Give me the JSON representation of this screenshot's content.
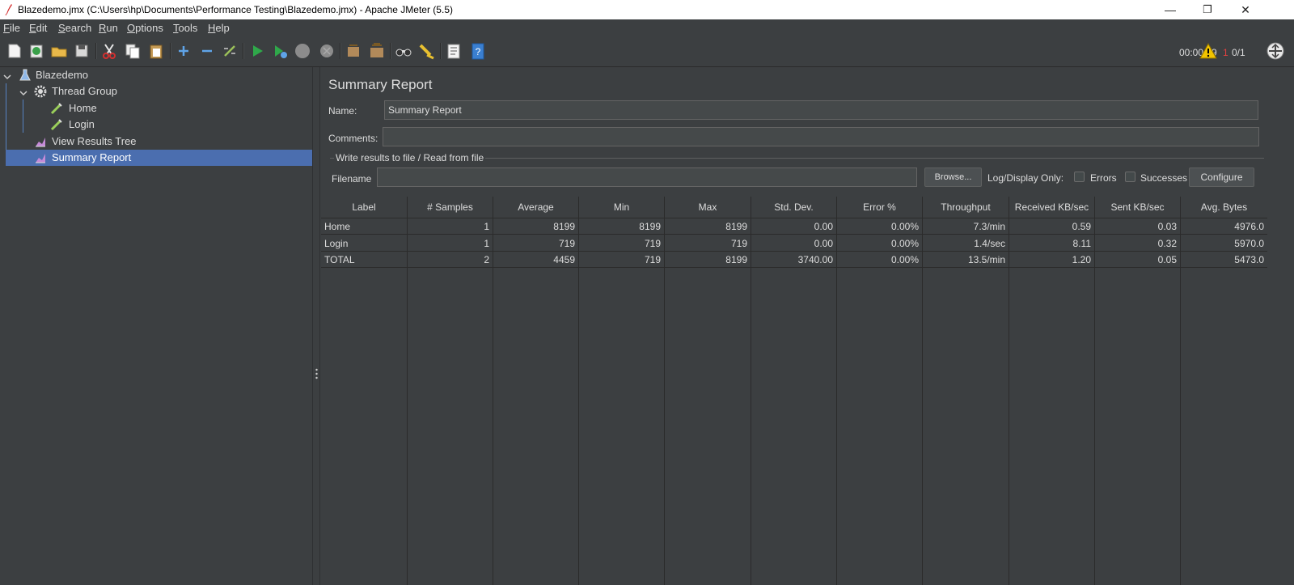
{
  "window": {
    "title": "Blazedemo.jmx (C:\\Users\\hp\\Documents\\Performance Testing\\Blazedemo.jmx) - Apache JMeter (5.5)",
    "minimize": "—",
    "maximize": "❐",
    "close": "✕"
  },
  "menu": [
    "File",
    "Edit",
    "Search",
    "Run",
    "Options",
    "Tools",
    "Help"
  ],
  "status": {
    "elapsed": "00:00:09",
    "errors": "1",
    "threads": "0/1"
  },
  "tree": {
    "root": "Blazedemo",
    "thread_group": "Thread Group",
    "samplers": [
      "Home",
      "Login"
    ],
    "listeners": [
      "View Results Tree",
      "Summary Report"
    ]
  },
  "panel": {
    "title": "Summary Report",
    "name_label": "Name:",
    "name_value": "Summary Report",
    "comments_label": "Comments:",
    "comments_value": "",
    "file_group": "Write results to file / Read from file",
    "filename_label": "Filename",
    "filename_value": "",
    "browse": "Browse...",
    "log_display": "Log/Display Only:",
    "errors": "Errors",
    "successes": "Successes",
    "configure": "Configure"
  },
  "table": {
    "headers": [
      "Label",
      "# Samples",
      "Average",
      "Min",
      "Max",
      "Std. Dev.",
      "Error %",
      "Throughput",
      "Received KB/sec",
      "Sent KB/sec",
      "Avg. Bytes"
    ],
    "rows": [
      [
        "Home",
        "1",
        "8199",
        "8199",
        "8199",
        "0.00",
        "0.00%",
        "7.3/min",
        "0.59",
        "0.03",
        "4976.0"
      ],
      [
        "Login",
        "1",
        "719",
        "719",
        "719",
        "0.00",
        "0.00%",
        "1.4/sec",
        "8.11",
        "0.32",
        "5970.0"
      ],
      [
        "TOTAL",
        "2",
        "4459",
        "719",
        "8199",
        "3740.00",
        "0.00%",
        "13.5/min",
        "1.20",
        "0.05",
        "5473.0"
      ]
    ]
  }
}
